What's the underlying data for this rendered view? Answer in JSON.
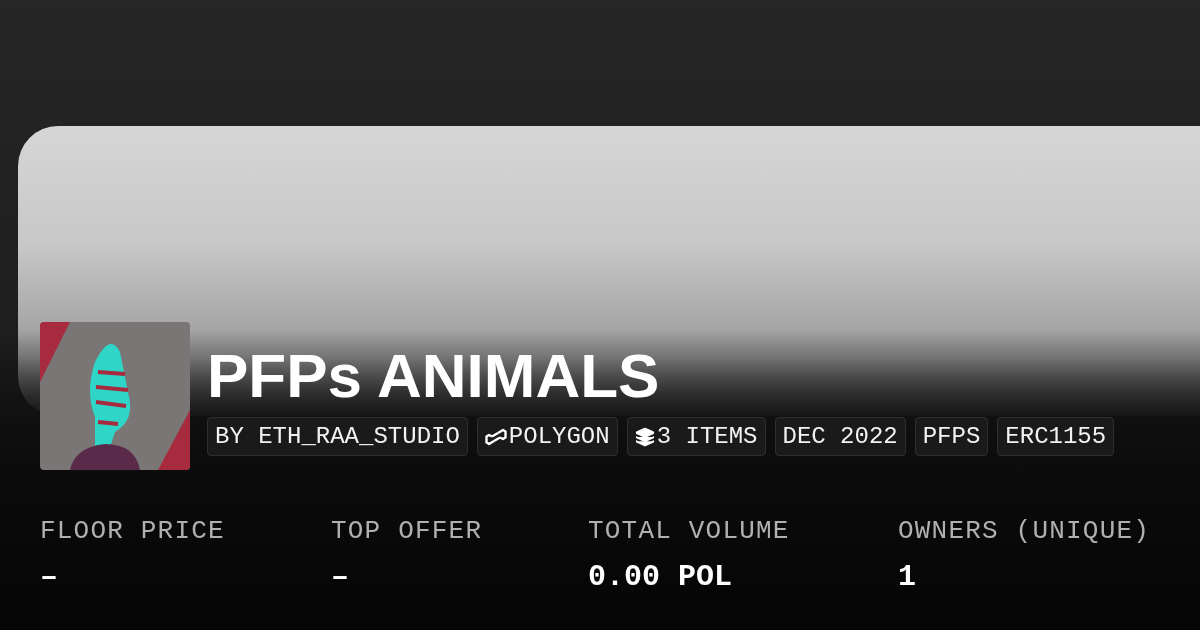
{
  "collection": {
    "title": "PFPs ANIMALS",
    "tags": [
      {
        "kind": "text",
        "label": "BY ETH_RAA_STUDIO"
      },
      {
        "kind": "chain",
        "label": "POLYGON"
      },
      {
        "kind": "items",
        "label": "3 ITEMS"
      },
      {
        "kind": "text",
        "label": "DEC 2022"
      },
      {
        "kind": "text",
        "label": "PFPS"
      },
      {
        "kind": "text",
        "label": "ERC1155"
      }
    ]
  },
  "stats": [
    {
      "label": "FLOOR PRICE",
      "value": "–"
    },
    {
      "label": "TOP OFFER",
      "value": "–"
    },
    {
      "label": "TOTAL VOLUME",
      "value": "0.00 POL"
    },
    {
      "label": "OWNERS (UNIQUE)",
      "value": "1"
    }
  ]
}
